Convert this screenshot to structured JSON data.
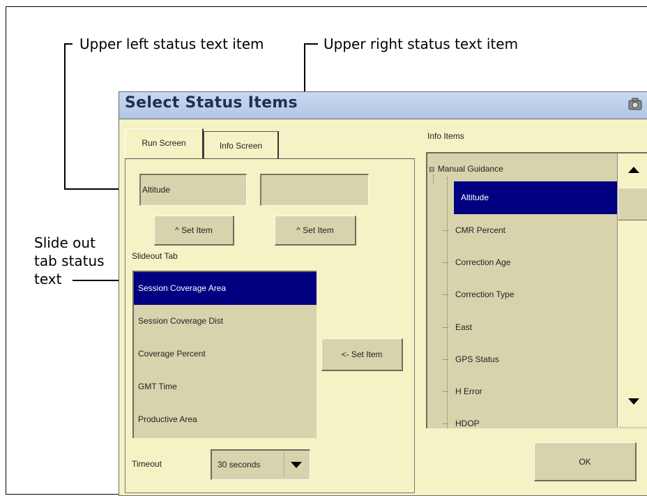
{
  "callouts": {
    "upper_left": "Upper left status text item",
    "upper_right": "Upper right status text item",
    "slideout_line1": "Slide out",
    "slideout_line2": "tab status",
    "slideout_line3": "text"
  },
  "dialog": {
    "title": "Select Status Items",
    "tabs": [
      "Run Screen",
      "Info Screen"
    ],
    "upper_left_value": "Altitude",
    "upper_right_value": "",
    "set_item_left": "^ Set Item",
    "set_item_right": "^ Set Item",
    "slideout_label": "Slideout Tab",
    "slideout_items": [
      "Session Coverage Area",
      "Session Coverage Dist",
      "Coverage Percent",
      "GMT Time",
      "Productive Area"
    ],
    "selected_slideout_index": 0,
    "set_item_middle": "<- Set Item",
    "timeout_label": "Timeout",
    "timeout_value": "30 seconds",
    "info_items_label": "Info Items",
    "tree_root": "Manual Guidance",
    "tree_expander": "⊟",
    "tree_items": [
      "Altitude",
      "CMR Percent",
      "Correction Age",
      "Correction Type",
      "East",
      "GPS Status",
      "H Error",
      "HDOP"
    ],
    "selected_tree_index": 0,
    "ok_label": "OK"
  },
  "colors": {
    "dialog_bg": "#f5f2c6",
    "control_bg": "#d7d3ad",
    "selection": "#000080",
    "titlebar": "#b0c6e6"
  }
}
